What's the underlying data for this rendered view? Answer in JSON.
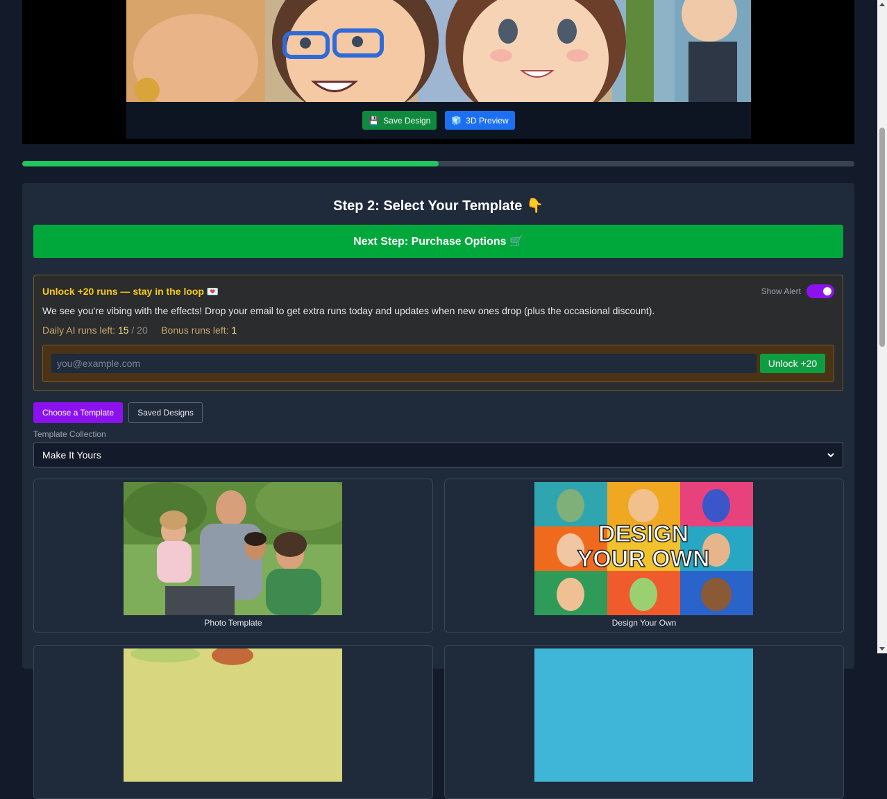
{
  "preview": {
    "save_label": "Save Design",
    "preview3d_label": "3D Preview",
    "save_icon": "💾",
    "cube_icon": "🧊"
  },
  "progress": {
    "percent": 50
  },
  "step": {
    "title": "Step 2: Select Your Template",
    "title_icon": "👇",
    "next_label": "Next Step: Purchase Options",
    "next_icon": "🛒"
  },
  "alert": {
    "title": "Unlock +20 runs — stay in the loop",
    "title_icon": "💌",
    "toggle_label": "Show Alert",
    "toggle_on": true,
    "message": "We see you're vibing with the effects! Drop your email to get extra runs today and updates when new ones drop (plus the occasional discount).",
    "daily_label": "Daily AI runs left:",
    "daily_left": "15",
    "daily_total": "/ 20",
    "bonus_label": "Bonus runs left:",
    "bonus_left": "1",
    "email_placeholder": "you@example.com",
    "unlock_label": "Unlock +20"
  },
  "tabs": [
    {
      "label": "Choose a Template",
      "active": true
    },
    {
      "label": "Saved Designs",
      "active": false
    }
  ],
  "collection": {
    "label": "Template Collection",
    "selected": "Make It Yours"
  },
  "templates": [
    {
      "label": "Photo Template"
    },
    {
      "label": "Design Your Own",
      "overlay_line1": "DESIGN",
      "overlay_line2": "YOUR OWN"
    }
  ],
  "colors": {
    "accent_green": "#00a83b",
    "accent_purple": "#8b12ee",
    "accent_blue": "#1d6ff2",
    "alert_yellow": "#facc15"
  }
}
